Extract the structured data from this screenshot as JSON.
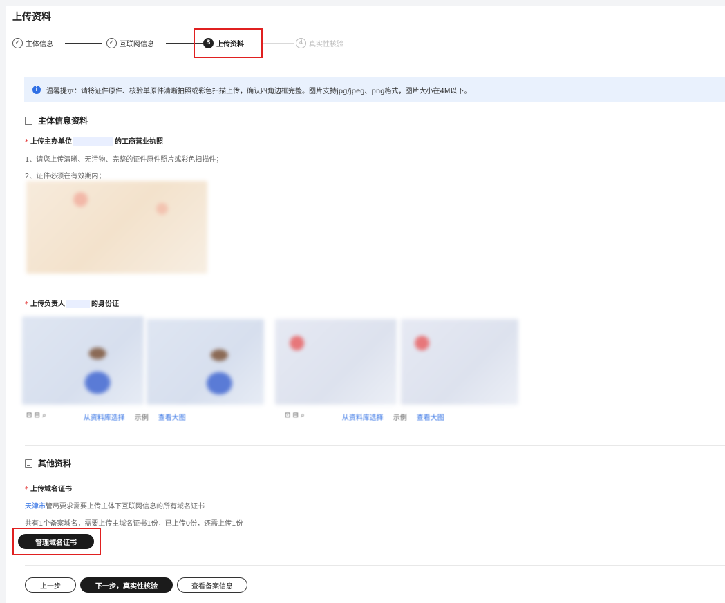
{
  "page": {
    "title": "上传资料"
  },
  "steps": [
    {
      "label": "主体信息",
      "state": "done"
    },
    {
      "label": "互联网信息",
      "state": "done"
    },
    {
      "label": "上传资料",
      "state": "active",
      "number": "3"
    },
    {
      "label": "真实性核验",
      "state": "todo",
      "number": "4"
    }
  ],
  "notice": {
    "icon": "info-icon",
    "text": "温馨提示：请将证件原件、核验单原件清晰拍照或彩色扫描上传，确认四角边框完整。图片支持jpg/jpeg、png格式，图片大小在4M以下。"
  },
  "subject_section": {
    "title": "主体信息资料",
    "license": {
      "label_prefix": "上传主办单位",
      "label_suffix": "的工商营业执照",
      "hints": [
        "1、请您上传清晰、无污物、完整的证件原件照片或彩色扫描件；",
        "2、证件必须在有效期内；"
      ]
    },
    "id_card": {
      "label_prefix": "上传负责人",
      "label_suffix": "的身份证",
      "actions_left": {
        "library": "从资料库选择",
        "example": "示例",
        "view": "查看大图"
      },
      "actions_right": {
        "library": "从资料库选择",
        "example": "示例",
        "view": "查看大图"
      }
    }
  },
  "other_section": {
    "title": "其他资料",
    "domain_cert": {
      "label": "上传域名证书",
      "region": "天津市",
      "region_note": "管局要求需要上传主体下互联网信息的所有域名证书",
      "status_text": "共有1个备案域名，需要上传主域名证书1份，已上传0份，还需上传1份",
      "manage_button": "管理域名证书"
    }
  },
  "footer": {
    "prev_button": "上一步",
    "next_button": "下一步，真实性核验",
    "view_button": "查看备案信息"
  },
  "colors": {
    "accent": "#2f6fe4",
    "highlight": "#e02020",
    "dark_button": "#1b1b1b"
  }
}
